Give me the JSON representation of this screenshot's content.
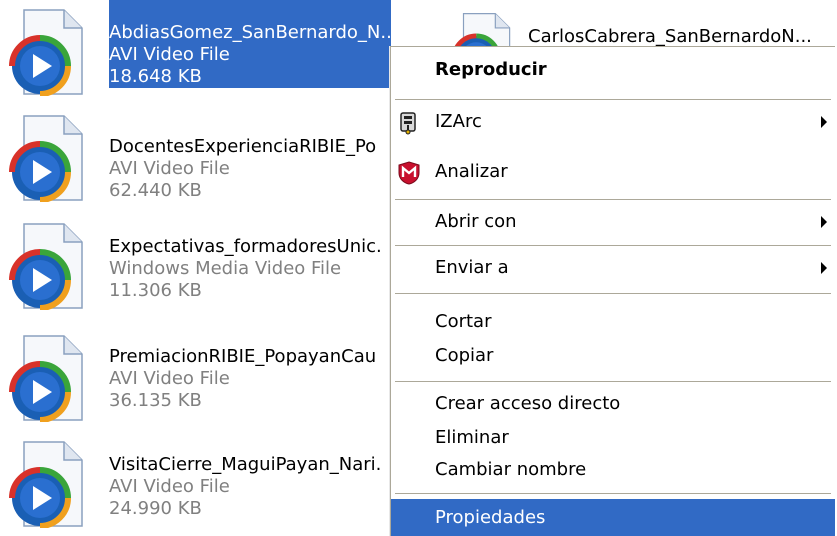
{
  "files": [
    {
      "name": "AbdiasGomez_SanBernardo_N...",
      "type": "AVI Video File",
      "size": "18.648 KB",
      "icon": "windows-media-file-icon"
    },
    {
      "name": "DocentesExperienciaRIBIE_Po",
      "type": "AVI Video File",
      "size": "62.440 KB",
      "icon": "windows-media-file-icon"
    },
    {
      "name": "Expectativas_formadoresUnic.",
      "type": "Windows Media Video File",
      "size": "11.306 KB",
      "icon": "windows-media-file-icon"
    },
    {
      "name": "PremiacionRIBIE_PopayanCau",
      "type": "AVI Video File",
      "size": "36.135 KB",
      "icon": "windows-media-file-icon"
    },
    {
      "name": "VisitaCierre_MaguiPayan_Nari.",
      "type": "AVI Video File",
      "size": "24.990 KB",
      "icon": "windows-media-file-icon"
    }
  ],
  "file_right": {
    "name": "CarlosCabrera_SanBernardoN...",
    "icon": "windows-media-file-icon"
  },
  "menu": {
    "play": "Reproducir",
    "izarc": "IZArc",
    "izarc_icon": "izarc-icon",
    "scan": "Analizar",
    "scan_icon": "mcafee-shield-icon",
    "open_with": "Abrir con",
    "send_to": "Enviar a",
    "cut": "Cortar",
    "copy": "Copiar",
    "create_shortcut": "Crear acceso directo",
    "delete": "Eliminar",
    "rename": "Cambiar nombre",
    "properties": "Propiedades"
  },
  "colors": {
    "selection": "#316ac5",
    "secondary_text": "#808080",
    "separator": "#aca899"
  }
}
